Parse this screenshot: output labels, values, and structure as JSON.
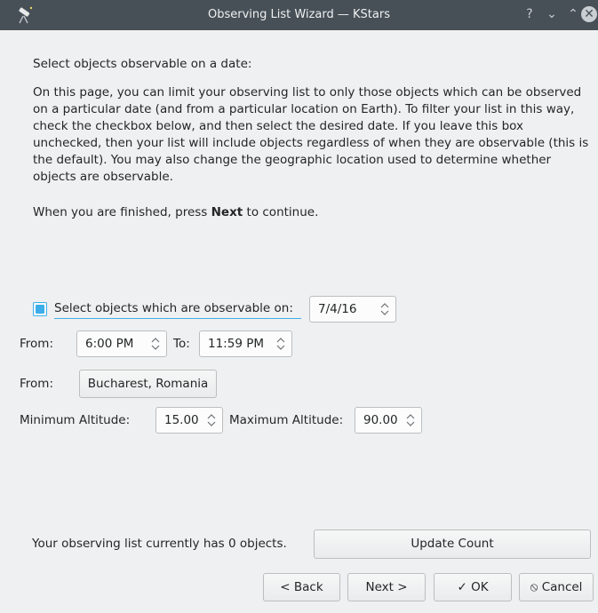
{
  "window": {
    "title": "Observing List Wizard — KStars",
    "help_glyph": "?",
    "min_glyph": "⌄",
    "max_glyph": "⌃",
    "close_glyph": "✕"
  },
  "intro": {
    "heading": "Select objects observable on a date:",
    "paragraph": "On this page, you can limit your observing list to only those objects which can be observed on a particular date (and from a particular location on Earth). To filter your list in this way, check the checkbox below, and then select the desired date. If you leave this box unchecked, then your list will include objects regardless of when they are observable (this is the default). You may also change the geographic location used to determine whether objects are observable.",
    "finish_prefix": "When you are finished, press ",
    "finish_bold": "Next",
    "finish_suffix": " to continue."
  },
  "date_filter": {
    "checkbox_label": "Select objects which are observable on:",
    "checked": true,
    "date_value": "7/4/16"
  },
  "time": {
    "from_label": "From:",
    "from_value": "6:00 PM",
    "to_label": "To:",
    "to_value": "11:59 PM"
  },
  "location": {
    "from_label": "From:",
    "button_label": "Bucharest, Romania"
  },
  "altitude": {
    "min_label": "Minimum Altitude:",
    "min_value": "15.00",
    "max_label": "Maximum Altitude:",
    "max_value": "90.00"
  },
  "count": {
    "status_text": "Your observing list currently has 0 objects.",
    "update_button": "Update Count"
  },
  "footer": {
    "back": "< Back",
    "next": "Next >",
    "ok": "OK",
    "cancel": "Cancel"
  },
  "colors": {
    "accent": "#3daee9",
    "titlebar": "#475057",
    "background": "#eff0f1"
  }
}
